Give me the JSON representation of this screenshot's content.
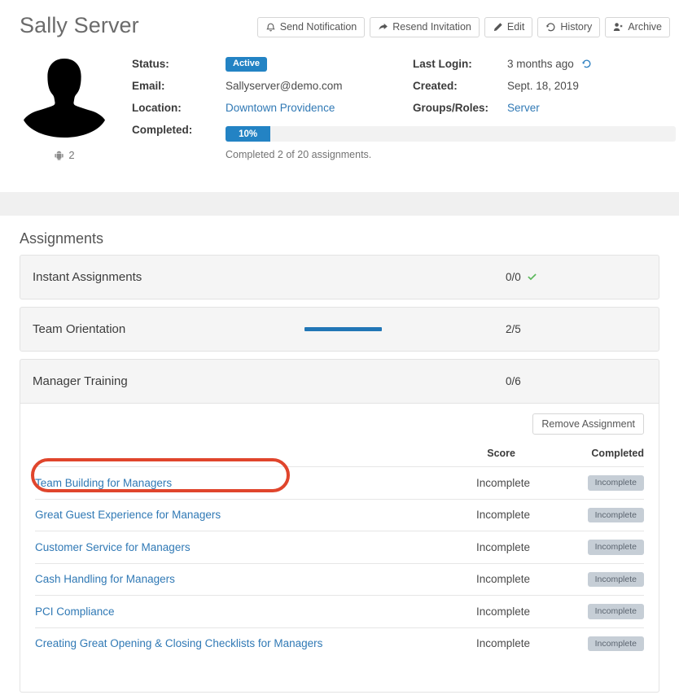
{
  "header": {
    "title": "Sally Server",
    "toolbar": [
      {
        "label": "Send Notification",
        "icon": "bell-icon"
      },
      {
        "label": "Resend Invitation",
        "icon": "share-arrow-icon"
      },
      {
        "label": "Edit",
        "icon": "pencil-icon"
      },
      {
        "label": "History",
        "icon": "history-icon"
      },
      {
        "label": "Archive",
        "icon": "user-times-icon"
      }
    ]
  },
  "profile": {
    "avatar_alt": "user-silhouette",
    "device_icon": "android-icon",
    "device_count": "2",
    "left_fields": [
      {
        "label": "Status:",
        "value": "Active",
        "type": "badge"
      },
      {
        "label": "Email:",
        "value": "Sallyserver@demo.com",
        "type": "text"
      },
      {
        "label": "Location:",
        "value": "Downtown Providence",
        "type": "link"
      },
      {
        "label": "Completed:",
        "value": "",
        "type": "progress"
      }
    ],
    "right_fields": [
      {
        "label": "Last Login:",
        "value": "3 months ago",
        "type": "text-with-icon",
        "icon": "history-icon"
      },
      {
        "label": "Created:",
        "value": "Sept. 18, 2019",
        "type": "text"
      },
      {
        "label": "Groups/Roles:",
        "value": "Server",
        "type": "link"
      }
    ],
    "progress": {
      "percent_label": "10%",
      "percent_value": 10,
      "note": "Completed 2 of 20 assignments."
    }
  },
  "assignments": {
    "section_title": "Assignments",
    "items": [
      {
        "name": "Instant Assignments",
        "count": "0/0",
        "complete_check": true,
        "progress_percent": 0,
        "show_bar": false,
        "expanded": false
      },
      {
        "name": "Team Orientation",
        "count": "2/5",
        "complete_check": false,
        "progress_percent": 100,
        "show_bar": true,
        "expanded": false
      },
      {
        "name": "Manager Training",
        "count": "0/6",
        "complete_check": false,
        "progress_percent": 0,
        "show_bar": false,
        "expanded": true
      }
    ],
    "expanded_panel": {
      "remove_button": "Remove Assignment",
      "columns": {
        "name": "",
        "score": "Score",
        "completed": "Completed"
      },
      "rows": [
        {
          "name": "Team Building for Managers",
          "score": "Incomplete",
          "completed": "Incomplete",
          "highlighted": true
        },
        {
          "name": "Great Guest Experience for Managers",
          "score": "Incomplete",
          "completed": "Incomplete",
          "highlighted": false
        },
        {
          "name": "Customer Service for Managers",
          "score": "Incomplete",
          "completed": "Incomplete",
          "highlighted": false
        },
        {
          "name": "Cash Handling for Managers",
          "score": "Incomplete",
          "completed": "Incomplete",
          "highlighted": false
        },
        {
          "name": "PCI Compliance",
          "score": "Incomplete",
          "completed": "Incomplete",
          "highlighted": false
        },
        {
          "name": "Creating Great Opening & Closing Checklists for Managers",
          "score": "Incomplete",
          "completed": "Incomplete",
          "highlighted": false
        }
      ]
    }
  },
  "colors": {
    "accent_blue": "#2383c4",
    "link_blue": "#3079b5",
    "check_green": "#5cb85c",
    "badge_grey": "#c6ced6",
    "annotation_red": "#e0452c",
    "page_bg": "#f0f0f0"
  }
}
